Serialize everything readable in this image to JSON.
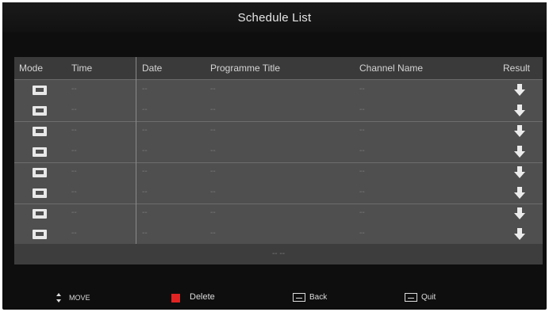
{
  "title": "Schedule List",
  "colors": {
    "delete_key": "#e02424"
  },
  "table": {
    "headers": {
      "mode": "Mode",
      "time": "Time",
      "date": "Date",
      "programme_title": "Programme Title",
      "channel_name": "Channel Name",
      "result": "Result"
    },
    "rows": [
      {
        "mode_icon": "tv-icon",
        "time": "--",
        "date": "--",
        "programme_title": "--",
        "channel_name": "--",
        "result_icon": "download-arrow-icon"
      },
      {
        "mode_icon": "tv-icon",
        "time": "--",
        "date": "--",
        "programme_title": "--",
        "channel_name": "--",
        "result_icon": "download-arrow-icon"
      },
      {
        "mode_icon": "tv-icon",
        "time": "--",
        "date": "--",
        "programme_title": "--",
        "channel_name": "--",
        "result_icon": "download-arrow-icon"
      },
      {
        "mode_icon": "tv-icon",
        "time": "--",
        "date": "--",
        "programme_title": "--",
        "channel_name": "--",
        "result_icon": "download-arrow-icon"
      },
      {
        "mode_icon": "tv-icon",
        "time": "--",
        "date": "--",
        "programme_title": "--",
        "channel_name": "--",
        "result_icon": "download-arrow-icon"
      },
      {
        "mode_icon": "tv-icon",
        "time": "--",
        "date": "--",
        "programme_title": "--",
        "channel_name": "--",
        "result_icon": "download-arrow-icon"
      },
      {
        "mode_icon": "tv-icon",
        "time": "--",
        "date": "--",
        "programme_title": "--",
        "channel_name": "--",
        "result_icon": "download-arrow-icon"
      },
      {
        "mode_icon": "tv-icon",
        "time": "--",
        "date": "--",
        "programme_title": "--",
        "channel_name": "--",
        "result_icon": "download-arrow-icon"
      }
    ],
    "page_indicator": "-- --"
  },
  "hints": {
    "move": "MOVE",
    "delete": "Delete",
    "back": "Back",
    "quit": "Quit"
  }
}
